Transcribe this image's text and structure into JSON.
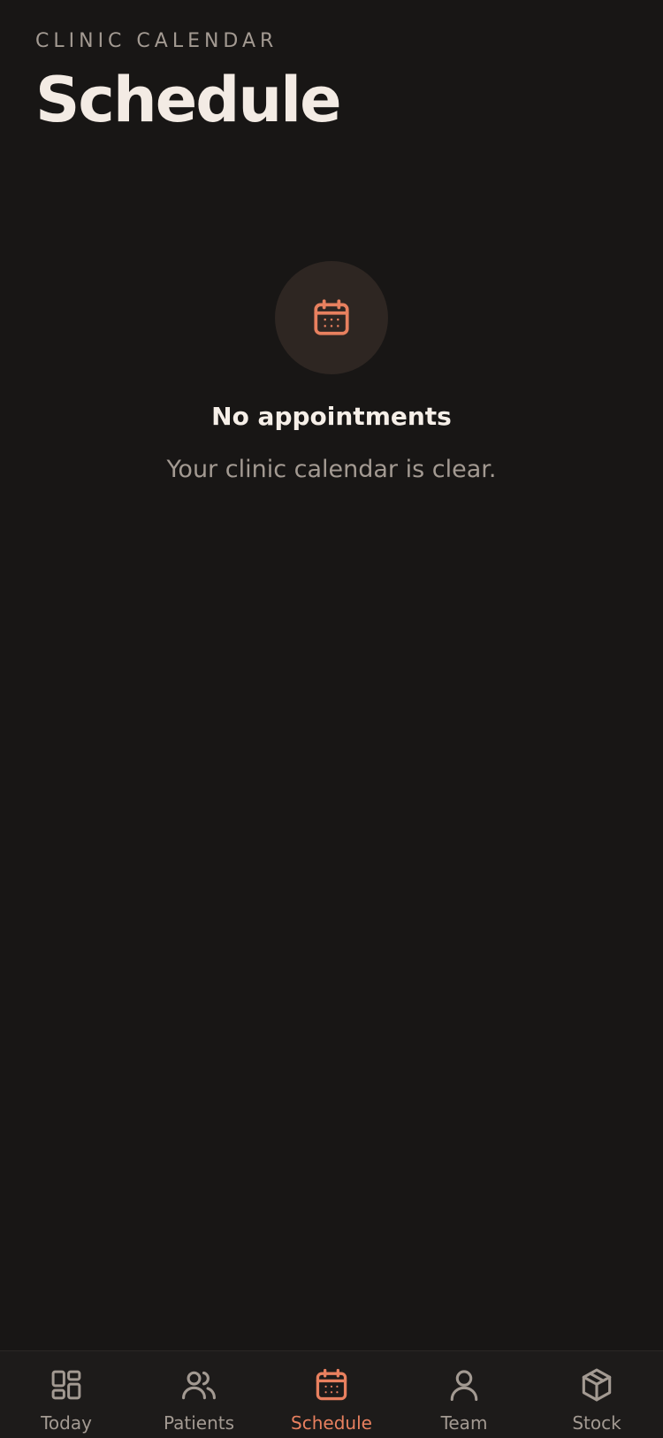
{
  "header": {
    "eyebrow": "CLINIC CALENDAR",
    "title": "Schedule"
  },
  "empty_state": {
    "icon": "calendar-icon",
    "title": "No appointments",
    "subtitle": "Your clinic calendar is clear."
  },
  "tabbar": {
    "active": "Schedule",
    "items": [
      {
        "label": "Today",
        "icon": "dashboard-grid-icon"
      },
      {
        "label": "Patients",
        "icon": "users-icon"
      },
      {
        "label": "Schedule",
        "icon": "calendar-icon"
      },
      {
        "label": "Team",
        "icon": "user-icon"
      },
      {
        "label": "Stock",
        "icon": "package-box-icon"
      }
    ]
  },
  "colors": {
    "background": "#181615",
    "accent": "#e8805f",
    "muted": "#a39a92",
    "text": "#f3ebe4"
  }
}
